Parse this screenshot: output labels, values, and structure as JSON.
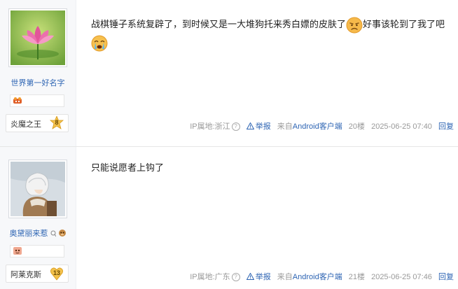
{
  "posts": [
    {
      "username": "世界第一好名字",
      "rank_name": "炎魔之王",
      "level": "8",
      "content": "战棋锤子系统复辟了，到时候又是一大堆狗托来秀白嫖的皮肤了",
      "content_after_emoji": "好事该轮到了我了吧",
      "meta": {
        "ip_location": "IP属地:浙江",
        "help_icon": "?",
        "report": "举报",
        "source_prefix": "来自",
        "source_client": "Android客户端",
        "floor": "20楼",
        "time": "2025-06-25 07:40",
        "reply": "回复"
      }
    },
    {
      "username": "奥黛丽来惹",
      "rank_name": "阿莱克斯",
      "level": "13",
      "content": "只能说愿者上钩了",
      "meta": {
        "ip_location": "IP属地:广东",
        "help_icon": "?",
        "report": "举报",
        "source_prefix": "来自",
        "source_client": "Android客户端",
        "floor": "21楼",
        "time": "2025-06-25 07:46",
        "reply": "回复"
      }
    }
  ],
  "colors": {
    "link": "#2d64b3",
    "meta_text": "#999999",
    "level_badge": "#f3c14b"
  },
  "icons": [
    "grumpy-face-icon",
    "crying-face-icon",
    "help-circle-icon",
    "warning-triangle-icon",
    "monster-badge-icon",
    "monkey-badge-icon",
    "level-star-icon",
    "level-heart-icon"
  ]
}
